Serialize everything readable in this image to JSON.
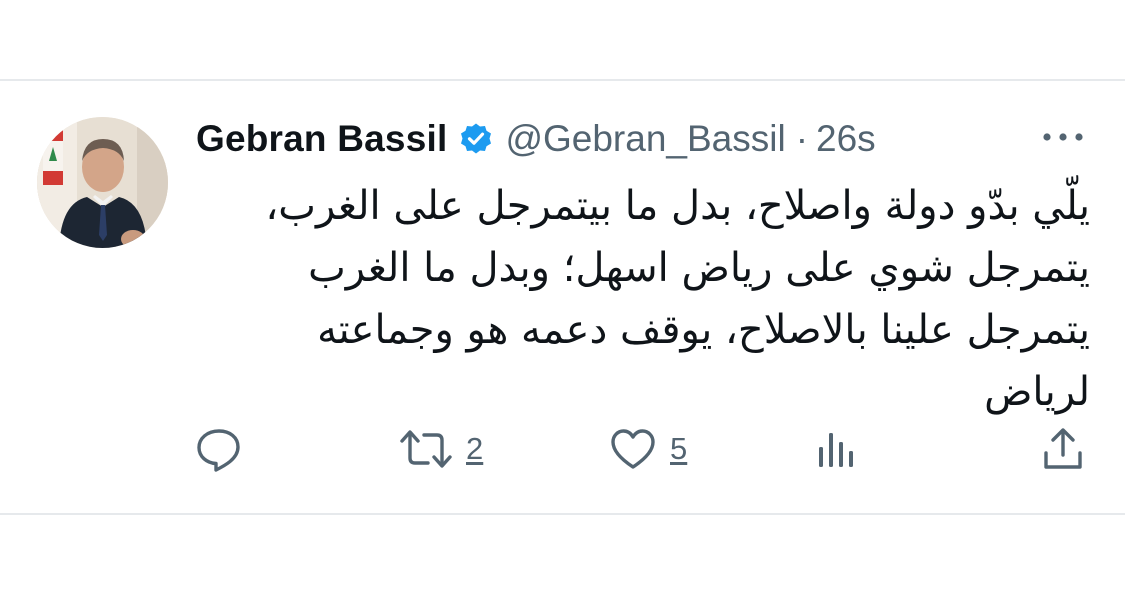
{
  "tweet": {
    "display_name": "Gebran Bassil",
    "handle": "@Gebran_Bassil",
    "separator": "·",
    "time": "26s",
    "verified": true,
    "body_lines": [
      "يلّي بدّو دولة واصلاح، بدل ما بيتمرجل على الغرب،",
      "يتمرجل شوي على رياض اسهل؛ وبدل ما الغرب",
      "يتمرجل علينا بالاصلاح، يوقف دعمه هو وجماعته",
      "لرياض"
    ]
  },
  "actions": {
    "reply": {
      "icon": "reply-icon",
      "count": ""
    },
    "retweet": {
      "icon": "retweet-icon",
      "count": "2"
    },
    "like": {
      "icon": "heart-icon",
      "count": "5"
    },
    "views": {
      "icon": "analytics-icon",
      "count": ""
    },
    "share": {
      "icon": "share-icon"
    }
  },
  "colors": {
    "text_primary": "#0f1419",
    "text_secondary": "#536471",
    "verified_blue": "#1d9bf0",
    "divider": "#e6e9ec"
  }
}
